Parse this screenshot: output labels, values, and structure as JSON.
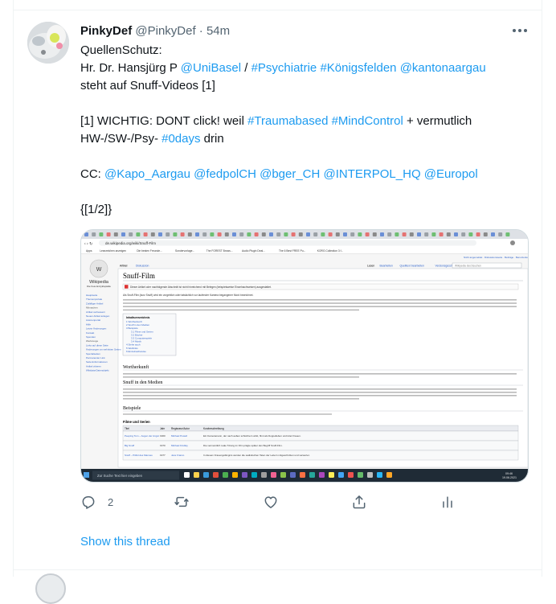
{
  "tweet": {
    "author_name": "PinkyDef",
    "author_handle": "@PinkyDef",
    "separator": "·",
    "time": "54m",
    "lines": [
      [
        {
          "t": "QuellenSchutz:"
        }
      ],
      [
        {
          "t": "Hr. Dr. Hansjürg P "
        },
        {
          "t": "@UniBasel",
          "link": true
        },
        {
          "t": " / "
        },
        {
          "t": "#Psychiatrie",
          "link": true
        },
        {
          "t": " "
        },
        {
          "t": "#Königsfelden",
          "link": true
        },
        {
          "t": " "
        },
        {
          "t": "@kantonaargau",
          "link": true
        }
      ],
      [
        {
          "t": "steht auf Snuff-Videos [1]"
        }
      ],
      [],
      [
        {
          "t": "[1] WICHTIG: DONT click! weil "
        },
        {
          "t": "#Traumabased",
          "link": true
        },
        {
          "t": " "
        },
        {
          "t": "#MindControl",
          "link": true
        },
        {
          "t": " + vermutlich"
        }
      ],
      [
        {
          "t": "HW-/SW-/Psy- "
        },
        {
          "t": "#0days",
          "link": true
        },
        {
          "t": " drin"
        }
      ],
      [],
      [
        {
          "t": "CC: "
        },
        {
          "t": "@Kapo_Aargau",
          "link": true
        },
        {
          "t": " "
        },
        {
          "t": "@fedpolCH",
          "link": true
        },
        {
          "t": " "
        },
        {
          "t": "@bger_CH",
          "link": true
        },
        {
          "t": " "
        },
        {
          "t": "@INTERPOL_HQ",
          "link": true
        },
        {
          "t": " "
        },
        {
          "t": "@Europol",
          "link": true
        }
      ],
      [],
      [
        {
          "t": "{[1/2]}"
        }
      ]
    ]
  },
  "screenshot": {
    "url": "de.wikipedia.org/wiki/Snuff-Film",
    "bookmarks": [
      "Apps",
      "Lesezeichen anzeigen",
      "Die besten Freunde...",
      "Sondervorlage...",
      "The FOREST Brows...",
      "Audio Plugin Deal...",
      "The 6 Best FREE Pu...",
      "KORG Collection 3 f..."
    ],
    "wiki_logo": "Wikipedia",
    "wiki_tagline": "Die freie Enzyklopädie",
    "tabs_left": [
      "Artikel",
      "Diskussion"
    ],
    "tabs_right": [
      "Lesen",
      "Bearbeiten",
      "Quelltext bearbeiten",
      "Versionsgeschichte"
    ],
    "search_placeholder": "Wikipedia durchsuchen",
    "sidebar_links": [
      "Hauptseite",
      "Themenportale",
      "Zufälliger Artikel",
      "Mitmachen",
      "Artikel verbessern",
      "Neuen Artikel anlegen",
      "Autorenportal",
      "Hilfe",
      "Letzte Änderungen",
      "Kontakt",
      "Spenden",
      "Werkzeuge",
      "Links auf diese Seite",
      "Änderungen an verlinkten Seiten",
      "Spezialseiten",
      "Permanenter Link",
      "Seiteninformationen",
      "Artikel zitieren",
      "Wikidata-Datenobjekt"
    ],
    "page_title": "Snuff-Film",
    "notice": "Dieser Artikel oder nachfolgende Abschnitt ist nicht hinreichend mit Belegen (beispielsweise Einzelnachweisen) ausgestattet.",
    "intro": "Als Snuff-Film (kurz Snuff) wird ein vorgeblich oder tatsächlich vor laufender Kamera begangener Mord bezeichnet.",
    "toc_title": "Inhaltsverzeichnis",
    "toc": [
      "1 Wortherkunft",
      "2 Snuff in den Medien",
      "3 Beispiele",
      "3.1 Filme und Serien",
      "3.2 Bücher",
      "3.3 Computerspiele",
      "3.4 Musik",
      "4 Siehe auch",
      "5 Weblinks",
      "6 Einzelnachweise"
    ],
    "h_wortherkunft": "Wortherkunft",
    "h_medien": "Snuff in den Medien",
    "h_beispiele": "Beispiele",
    "h_filme": "Filme und Serien",
    "table_headers": [
      "Titel",
      "Jahr",
      "Regisseur/Autor",
      "Kurzbeschreibung"
    ],
    "table_rows": [
      [
        "Peeping Tom – Augen der Angst",
        "1960",
        "Michael Powell",
        "Ein Kameramann, der nach außen schüchtern wirkt, filmt als Doppelleben und tötet Frauen."
      ],
      [
        "Big Snuff",
        "1970",
        "Michael Findlay",
        "Die vermeintlich reale Tötung im Film prägte später den Begriff Snuff-Film."
      ],
      [
        "Snuff – Pitiful des Mannes",
        "1977",
        "Jess Franco",
        "In diesem Frauengefängnis werden die sadistischen Taten der Leitern mitgeschnitten und verwertet."
      ]
    ],
    "taskbar_search": "Zur Suche Text hier eingeben",
    "taskbar_time": "09:46",
    "taskbar_date": "19.06.2021"
  },
  "actions": {
    "reply_count": "2",
    "retweet_count": "",
    "like_count": ""
  },
  "show_thread": "Show this thread",
  "colors": {
    "link": "#1d9bf0",
    "text": "#0f1419",
    "muted": "#536471",
    "border": "#eff3f4"
  }
}
